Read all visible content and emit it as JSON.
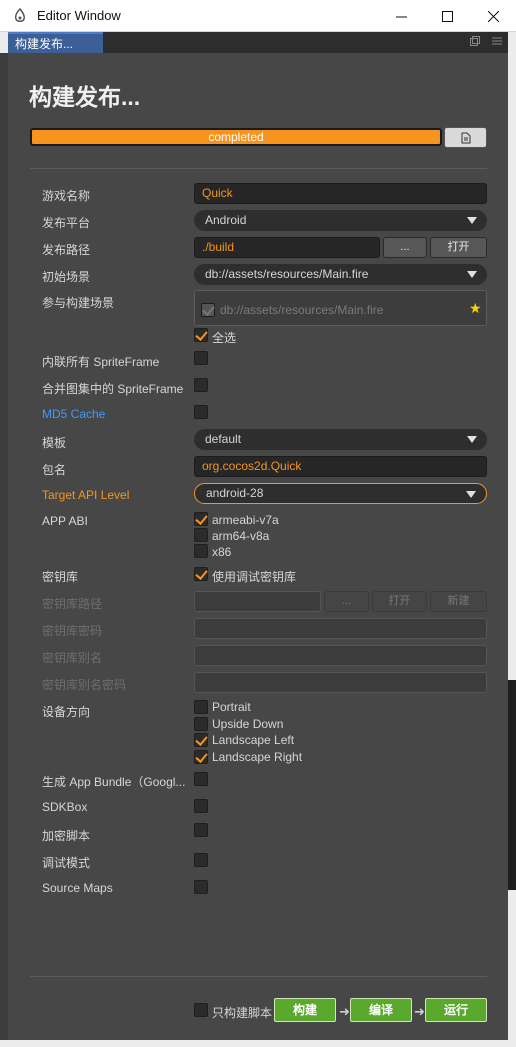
{
  "window": {
    "title": "Editor Window"
  },
  "tab": {
    "label": "构建发布..."
  },
  "heading": "构建发布...",
  "progress": {
    "text": "completed",
    "value": 1.0
  },
  "fields": {
    "game_name": {
      "label": "游戏名称",
      "value": "Quick"
    },
    "platform": {
      "label": "发布平台",
      "value": "Android"
    },
    "path": {
      "label": "发布路径",
      "value": "./build",
      "dots": "...",
      "open": "打开"
    },
    "start_scene": {
      "label": "初始场景",
      "value": "db://assets/resources/Main.fire"
    },
    "scenes": {
      "label": "参与构建场景",
      "item": "db://assets/resources/Main.fire",
      "select_all": "全选"
    },
    "inline_sprite": {
      "label": "内联所有 SpriteFrame"
    },
    "merge_sprite": {
      "label": "合并图集中的 SpriteFrame"
    },
    "md5": {
      "label": "MD5 Cache"
    },
    "template": {
      "label": "模板",
      "value": "default"
    },
    "package": {
      "label": "包名",
      "value": "org.cocos2d.Quick"
    },
    "api_level": {
      "label": "Target API Level",
      "value": "android-28"
    },
    "abi": {
      "label": "APP ABI",
      "options": [
        "armeabi-v7a",
        "arm64-v8a",
        "x86"
      ]
    },
    "keystore": {
      "label": "密钥库",
      "option": "使用调试密钥库"
    },
    "keystore_path": {
      "label": "密钥库路径",
      "dots": "...",
      "open": "打开",
      "new": "新建"
    },
    "keystore_pwd": {
      "label": "密钥库密码"
    },
    "keystore_alias": {
      "label": "密钥库别名"
    },
    "keystore_alias_pwd": {
      "label": "密钥库别名密码"
    },
    "orientation": {
      "label": "设备方向",
      "options": [
        "Portrait",
        "Upside Down",
        "Landscape Left",
        "Landscape Right"
      ]
    },
    "app_bundle": {
      "label": "生成 App Bundle（Googl..."
    },
    "sdkbox": {
      "label": "SDKBox"
    },
    "encrypt": {
      "label": "加密脚本"
    },
    "debug": {
      "label": "调试模式"
    },
    "source_maps": {
      "label": "Source Maps"
    }
  },
  "footer": {
    "build_script_only": "只构建脚本",
    "build": "构建",
    "compile": "编译",
    "run": "运行"
  },
  "colors": {
    "accent": "#f7941d",
    "link": "#3b9bff",
    "green": "#5aa82e",
    "panel": "#474747"
  }
}
